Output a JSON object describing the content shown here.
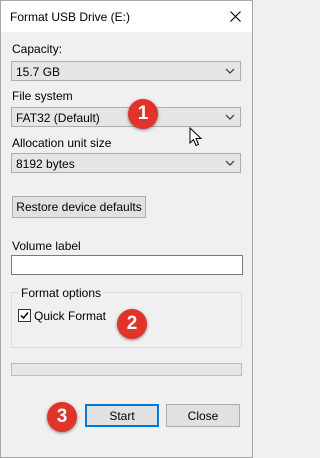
{
  "window": {
    "title": "Format USB Drive (E:)"
  },
  "capacity": {
    "label": "Capacity:",
    "value": "15.7 GB"
  },
  "file_system": {
    "label": "File system",
    "value": "FAT32 (Default)"
  },
  "allocation": {
    "label": "Allocation unit size",
    "value": "8192 bytes"
  },
  "restore_button": "Restore device defaults",
  "volume_label": {
    "label": "Volume label",
    "value": ""
  },
  "format_options": {
    "title": "Format options",
    "quick_format": {
      "label": "Quick Format",
      "checked": true
    }
  },
  "progress": {
    "value": 0
  },
  "buttons": {
    "start": "Start",
    "close": "Close"
  },
  "annotations": {
    "step1": "1",
    "step2": "2",
    "step3": "3"
  },
  "colors": {
    "annotation": "#e0342a",
    "focus_border": "#0078d7"
  },
  "icons": {
    "close": "close-icon",
    "dropdown": "chevron-down-icon",
    "check": "checkmark-icon",
    "cursor": "mouse-cursor-icon"
  }
}
